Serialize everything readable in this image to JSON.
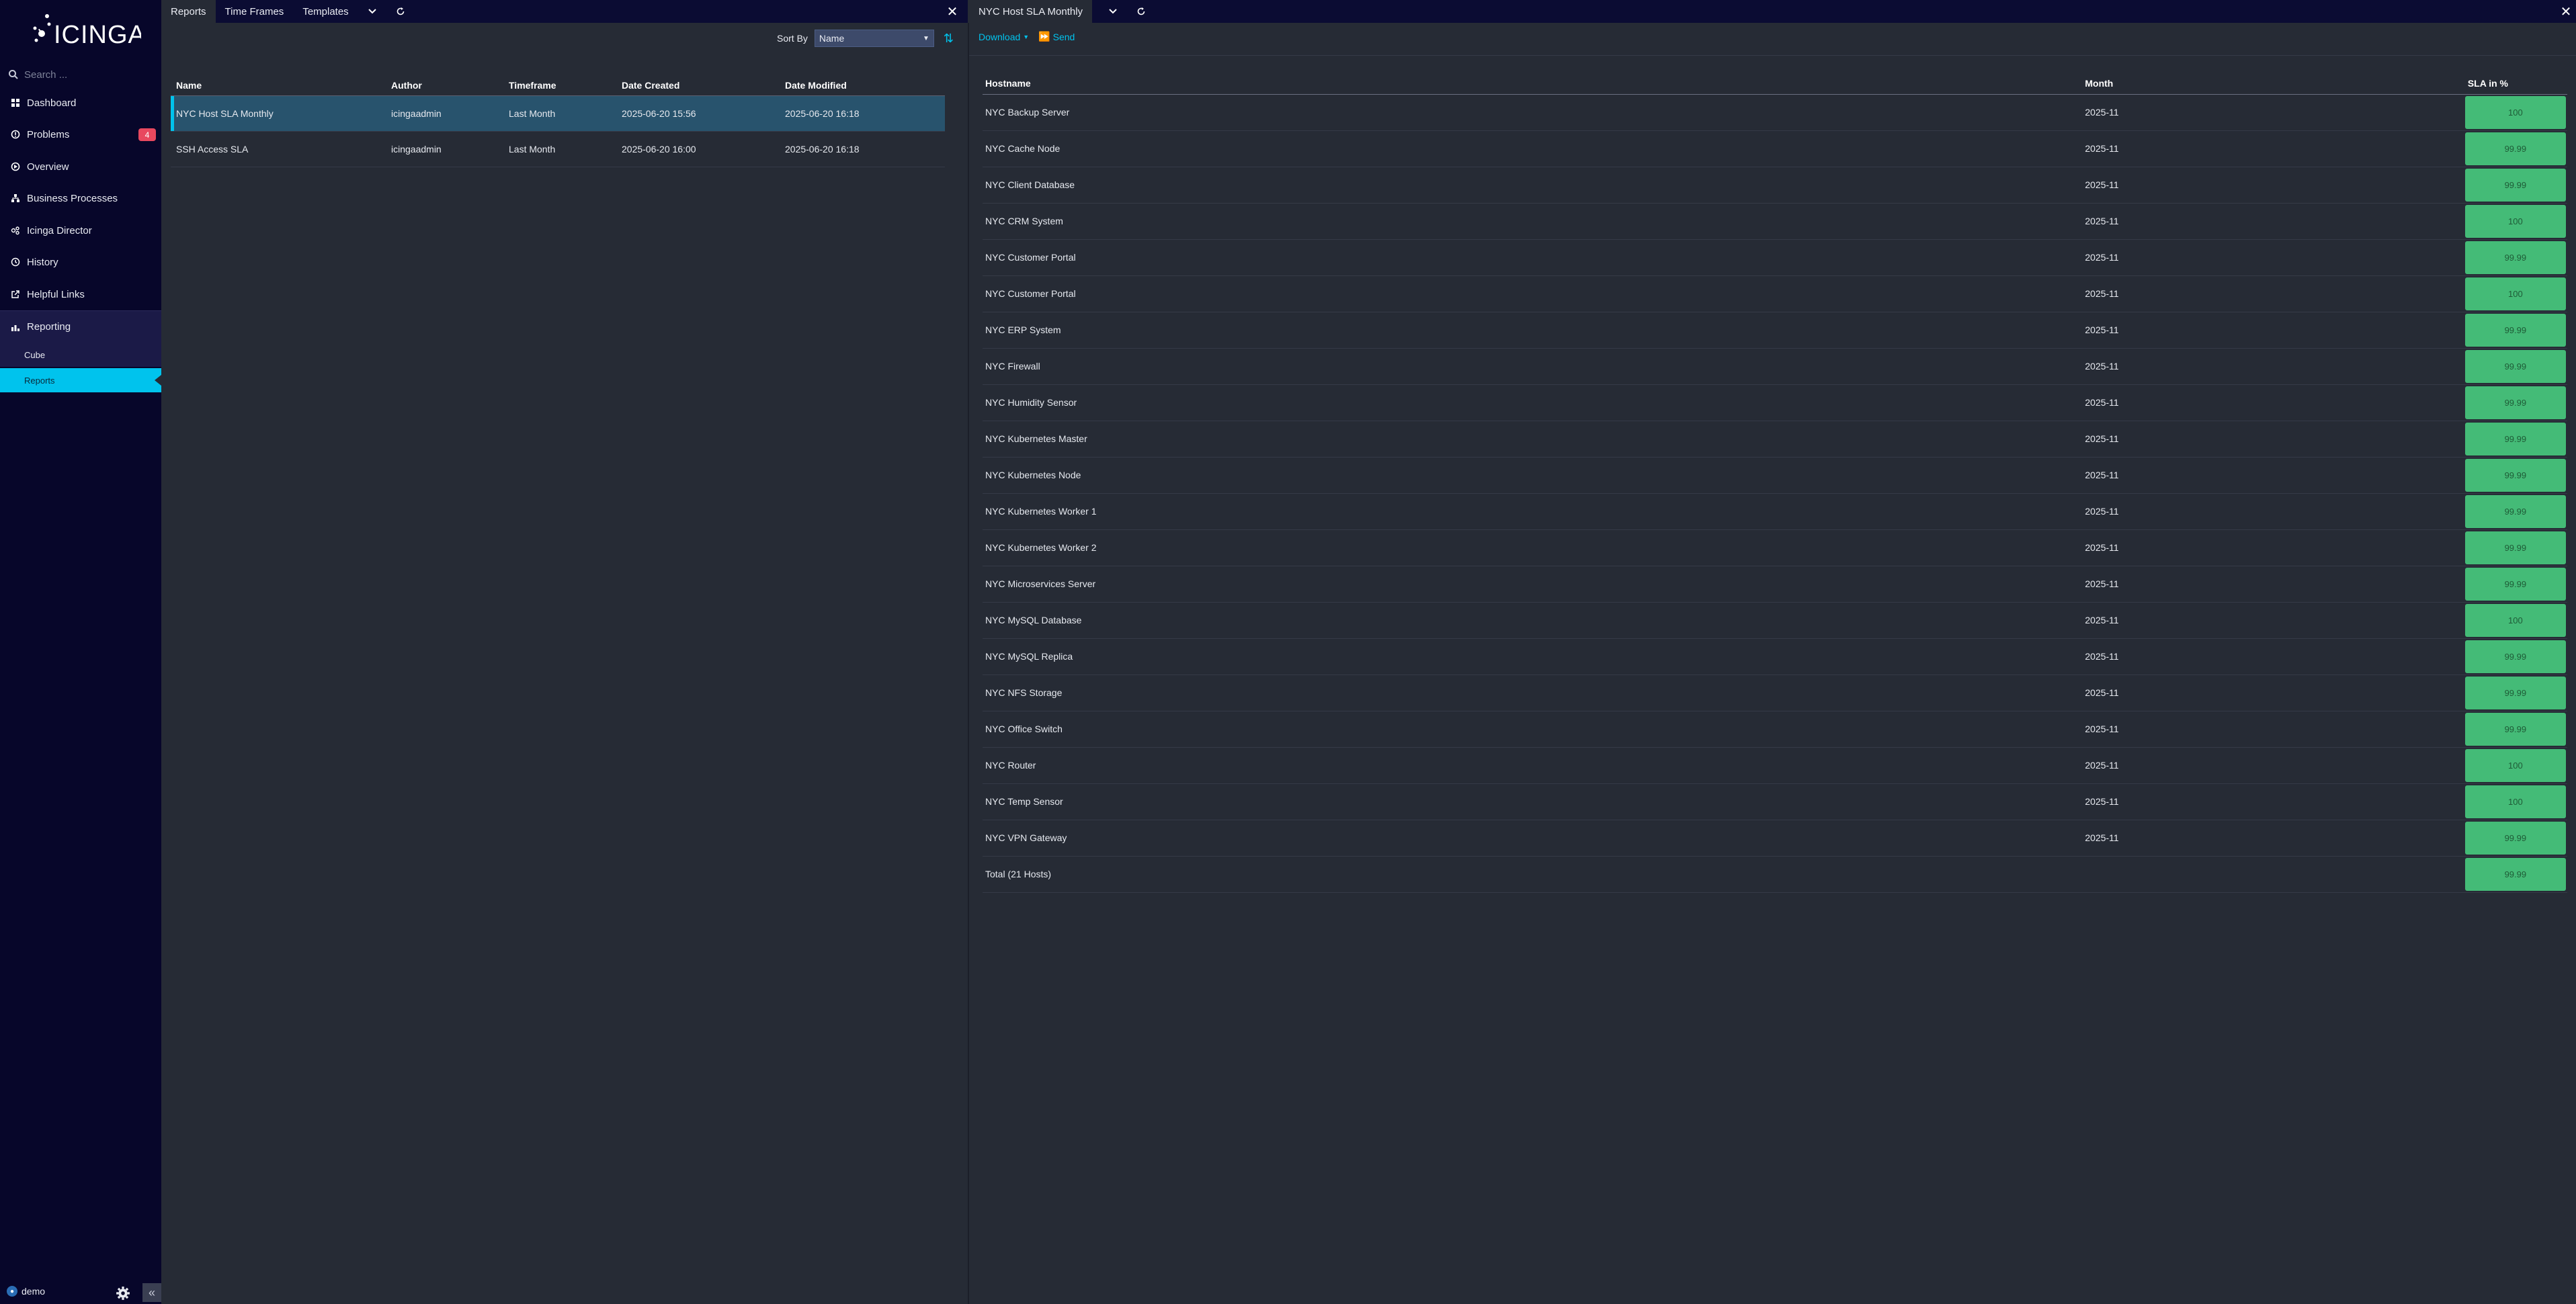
{
  "app": {
    "logo_text": "icinga"
  },
  "sidebar": {
    "search_placeholder": "Search ...",
    "items": [
      {
        "label": "Dashboard",
        "icon": "dashboard-icon"
      },
      {
        "label": "Problems",
        "icon": "problems-icon",
        "badge": "4"
      },
      {
        "label": "Overview",
        "icon": "overview-icon"
      },
      {
        "label": "Business Processes",
        "icon": "business-process-icon"
      },
      {
        "label": "Icinga Director",
        "icon": "director-icon"
      },
      {
        "label": "History",
        "icon": "history-icon"
      },
      {
        "label": "Helpful Links",
        "icon": "external-link-icon"
      },
      {
        "label": "Reporting",
        "icon": "reporting-icon"
      }
    ],
    "subitems": [
      {
        "label": "Cube"
      },
      {
        "label": "Reports"
      }
    ],
    "user": "demo"
  },
  "left_tabs": {
    "tabs": [
      "Reports",
      "Time Frames",
      "Templates"
    ]
  },
  "right_tabs": {
    "title": "NYC Host SLA Monthly"
  },
  "sort": {
    "label": "Sort By",
    "value": "Name"
  },
  "reports": {
    "columns": [
      "Name",
      "Author",
      "Timeframe",
      "Date Created",
      "Date Modified"
    ],
    "rows": [
      [
        "NYC Host SLA Monthly",
        "icingaadmin",
        "Last Month",
        "2025-06-20 15:56",
        "2025-06-20 16:18"
      ],
      [
        "SSH Access SLA",
        "icingaadmin",
        "Last Month",
        "2025-06-20 16:00",
        "2025-06-20 16:18"
      ]
    ]
  },
  "actions": {
    "download": "Download",
    "send": "Send"
  },
  "sla": {
    "columns": [
      "Hostname",
      "Month",
      "SLA in %"
    ],
    "rows": [
      [
        "NYC Backup Server",
        "2025-11",
        "100"
      ],
      [
        "NYC Cache Node",
        "2025-11",
        "99.99"
      ],
      [
        "NYC Client Database",
        "2025-11",
        "99.99"
      ],
      [
        "NYC CRM System",
        "2025-11",
        "100"
      ],
      [
        "NYC Customer Portal",
        "2025-11",
        "99.99"
      ],
      [
        "NYC Customer Portal",
        "2025-11",
        "100"
      ],
      [
        "NYC ERP System",
        "2025-11",
        "99.99"
      ],
      [
        "NYC Firewall",
        "2025-11",
        "99.99"
      ],
      [
        "NYC Humidity Sensor",
        "2025-11",
        "99.99"
      ],
      [
        "NYC Kubernetes Master",
        "2025-11",
        "99.99"
      ],
      [
        "NYC Kubernetes Node",
        "2025-11",
        "99.99"
      ],
      [
        "NYC Kubernetes Worker 1",
        "2025-11",
        "99.99"
      ],
      [
        "NYC Kubernetes Worker 2",
        "2025-11",
        "99.99"
      ],
      [
        "NYC Microservices Server",
        "2025-11",
        "99.99"
      ],
      [
        "NYC MySQL Database",
        "2025-11",
        "100"
      ],
      [
        "NYC MySQL Replica",
        "2025-11",
        "99.99"
      ],
      [
        "NYC NFS Storage",
        "2025-11",
        "99.99"
      ],
      [
        "NYC Office Switch",
        "2025-11",
        "99.99"
      ],
      [
        "NYC Router",
        "2025-11",
        "100"
      ],
      [
        "NYC Temp Sensor",
        "2025-11",
        "100"
      ],
      [
        "NYC VPN Gateway",
        "2025-11",
        "99.99"
      ]
    ],
    "total_label": "Total (21 Hosts)",
    "total_value": "99.99"
  },
  "colors": {
    "accent": "#00c3ed",
    "sla_ok": "#44bb77",
    "badge": "#e8485f",
    "sidebar_bg": "#07062a"
  }
}
